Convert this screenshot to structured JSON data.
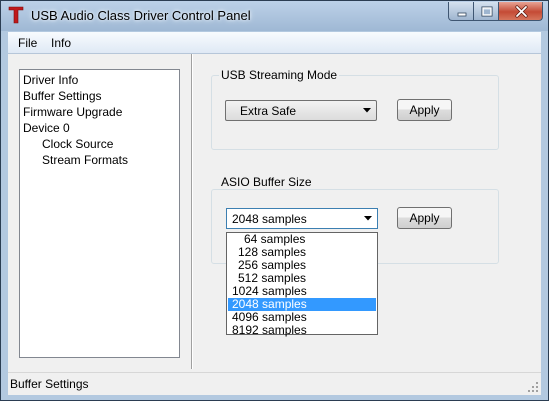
{
  "window": {
    "title": "USB Audio Class Driver Control Panel",
    "app_icon": "tascam-t-icon"
  },
  "menu": {
    "file": "File",
    "info": "Info"
  },
  "tree": {
    "items": [
      {
        "label": "Driver Info",
        "level": 0
      },
      {
        "label": "Buffer Settings",
        "level": 0
      },
      {
        "label": "Firmware Upgrade",
        "level": 0
      },
      {
        "label": "Device 0",
        "level": 0
      },
      {
        "label": "Clock Source",
        "level": 1
      },
      {
        "label": "Stream Formats",
        "level": 1
      }
    ]
  },
  "streaming": {
    "group_label": "USB Streaming Mode",
    "selected": "Extra Safe",
    "apply_label": "Apply"
  },
  "asio": {
    "group_label": "ASIO Buffer Size",
    "selected": "2048 samples",
    "apply_label": "Apply",
    "options": [
      "64 samples",
      "128 samples",
      "256 samples",
      "512 samples",
      "1024 samples",
      "2048 samples",
      "4096 samples",
      "8192 samples"
    ],
    "selected_index": 5
  },
  "status": {
    "text": "Buffer Settings"
  },
  "colors": {
    "selection": "#3399ff",
    "close_button": "#c44b35"
  }
}
